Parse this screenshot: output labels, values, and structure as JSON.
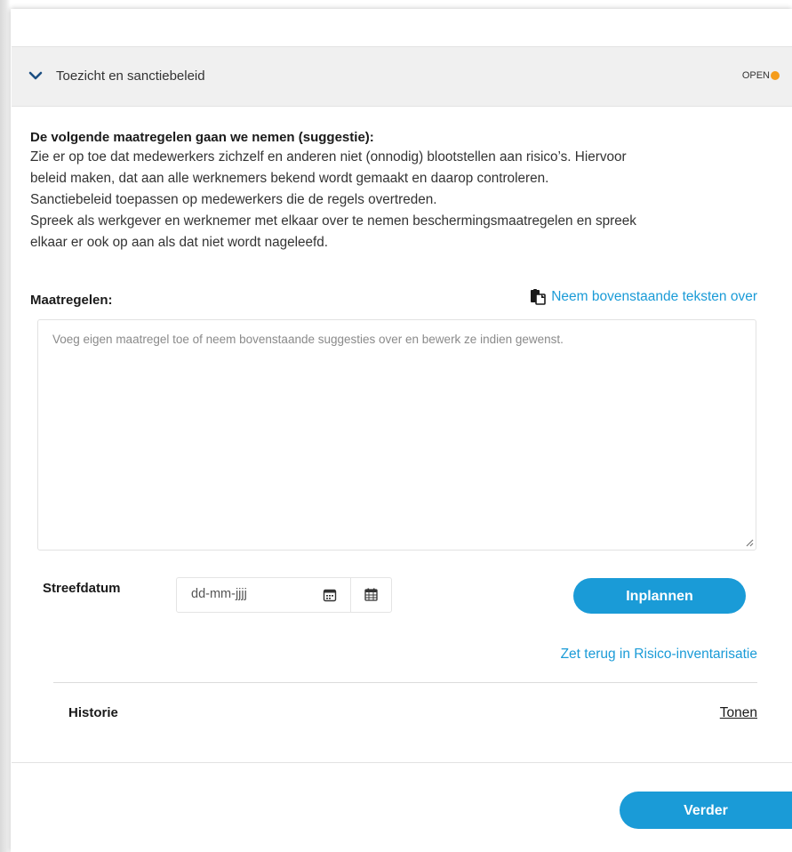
{
  "section": {
    "title": "Toezicht en sanctiebeleid",
    "status": "OPEN",
    "status_color": "#f59c1a",
    "chevron_icon": "chevron-down-icon"
  },
  "suggestion": {
    "heading": "De volgende maatregelen gaan we nemen (suggestie):",
    "lines": [
      "Zie er op toe dat medewerkers zichzelf en anderen niet (onnodig) blootstellen aan risico’s. Hiervoor",
      "beleid maken, dat aan alle werknemers bekend wordt gemaakt en daarop controleren.",
      "Sanctiebeleid toepassen op medewerkers die de regels overtreden.",
      "Spreek als werkgever en werknemer met elkaar over te nemen beschermingsmaatregelen en spreek",
      "elkaar er ook op aan als dat niet wordt nageleefd."
    ]
  },
  "measures": {
    "label": "Maatregelen:",
    "copy_link": "Neem bovenstaande teksten over",
    "copy_icon": "paste-icon",
    "value": "",
    "placeholder": "Voeg eigen maatregel toe of neem bovenstaande suggesties over en bewerk ze indien gewenst."
  },
  "target_date": {
    "label": "Streefdatum",
    "value": "dd-mm-jjjj",
    "picker_icon": "date-picker-icon",
    "calendar_icon": "calendar-icon"
  },
  "actions": {
    "plan_label": "Inplannen",
    "reset_link": "Zet terug in Risico-inventarisatie",
    "next_label": "Verder"
  },
  "history": {
    "label": "Historie",
    "toggle_label": "Tonen"
  },
  "colors": {
    "accent": "#1a9bd7",
    "header_bg": "#f0f0f0"
  }
}
